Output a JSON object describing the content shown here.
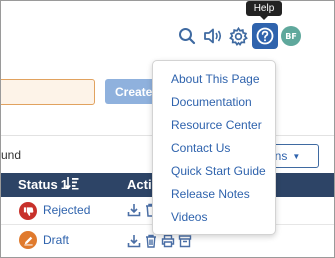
{
  "header": {
    "tooltip": "Help",
    "avatar_initials": "BF",
    "icons": [
      "search-icon",
      "speaker-icon",
      "gear-icon",
      "help-icon"
    ]
  },
  "toolbar": {
    "create_label": "Create",
    "search_value": "",
    "found_text": "und",
    "actions_label": "ons"
  },
  "table": {
    "status_header": "Status",
    "sort_order": "1",
    "action_header": "Actio",
    "rows": [
      {
        "status": "Rejected",
        "status_icon": "thumbs-down-icon",
        "status_color": "#c8312b"
      },
      {
        "status": "Draft",
        "status_icon": "edit-icon",
        "status_color": "#e07a2d"
      }
    ]
  },
  "help_menu": {
    "items": [
      "About This Page",
      "Documentation",
      "Resource Center",
      "Contact Us",
      "Quick Start Guide",
      "Release Notes",
      "Videos"
    ]
  },
  "colors": {
    "accent": "#2f63ad",
    "table_header": "#2d4466",
    "search_border": "#e1a25f"
  }
}
